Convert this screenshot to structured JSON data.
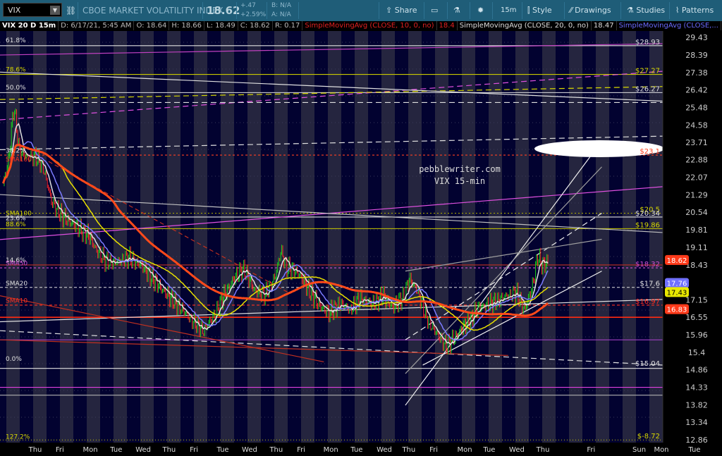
{
  "toolbar": {
    "symbol": "VIX",
    "description": "CBOE MARKET VOLATILITY INDEX",
    "last": "18.62",
    "change": "+.47",
    "change_pct": "+2.59%",
    "bid": "B: N/A",
    "ask": "A: N/A",
    "share": "Share",
    "timeframe": "15m",
    "style": "Style",
    "drawings": "Drawings",
    "studies": "Studies",
    "patterns": "Patterns"
  },
  "legend": {
    "title": "VIX 20 D 15m",
    "date": "D: 6/17/21, 5:45 AM",
    "open": "O: 18.64",
    "high": "H: 18.66",
    "low": "L: 18.49",
    "close": "C: 18.62",
    "range": "R: 0.17",
    "sma10": "SimpleMovingAvg (CLOSE, 10, 0, no)",
    "sma10_val": "18.4",
    "sma20": "SimpleMovingAvg (CLOSE, 20, 0, no)",
    "sma20_val": "18.47",
    "sma50": "SimpleMovingAvg (CLOSE,..."
  },
  "watermark": [
    "pebblewriter.com",
    "VIX 15-min"
  ],
  "chart_data": {
    "type": "line",
    "title": "VIX 15-min",
    "y_scale": "log",
    "ylim": [
      12.86,
      29.43
    ],
    "y_ticks": [
      "29.43",
      "28.39",
      "27.38",
      "26.42",
      "25.48",
      "24.58",
      "23.71",
      "22.88",
      "22.07",
      "21.29",
      "20.54",
      "19.81",
      "19.11",
      "18.43",
      "17.15",
      "16.55",
      "15.96",
      "15.4",
      "14.86",
      "14.33",
      "13.82",
      "13.34",
      "12.86"
    ],
    "x_ticks": [
      {
        "day": 0,
        "label": "Thu"
      },
      {
        "day": 0.92,
        "label": "Fri"
      },
      {
        "day": 2.06,
        "label": "Mon"
      },
      {
        "day": 3.03,
        "label": "Tue"
      },
      {
        "day": 4.04,
        "label": "Wed"
      },
      {
        "day": 5.01,
        "label": "Thu"
      },
      {
        "day": 5.94,
        "label": "Fri"
      },
      {
        "day": 7.02,
        "label": "Tue"
      },
      {
        "day": 8.02,
        "label": "Wed"
      },
      {
        "day": 9.02,
        "label": "Thu"
      },
      {
        "day": 9.95,
        "label": "Fri"
      },
      {
        "day": 11.06,
        "label": "Mon"
      },
      {
        "day": 12.03,
        "label": "Tue"
      },
      {
        "day": 13.06,
        "label": "Wed"
      },
      {
        "day": 13.98,
        "label": "Thu"
      },
      {
        "day": 14.91,
        "label": "Fri"
      },
      {
        "day": 16.07,
        "label": "Mon"
      },
      {
        "day": 16.99,
        "label": "Tue"
      },
      {
        "day": 18.02,
        "label": "Wed"
      },
      {
        "day": 18.998,
        "label": "Thu"
      },
      {
        "day": 20.8,
        "label": "Fri"
      },
      {
        "day": 22.6,
        "label": "Sun"
      },
      {
        "day": 23.43,
        "label": "Mon"
      },
      {
        "day": 24.67,
        "label": "Tue"
      }
    ],
    "close_path": [
      [
        -1.2,
        21.8
      ],
      [
        -1.0,
        22.8
      ],
      [
        -0.8,
        25.6
      ],
      [
        -0.6,
        23.3
      ],
      [
        -0.3,
        23.0
      ],
      [
        0,
        23.0
      ],
      [
        0.3,
        22.5
      ],
      [
        0.6,
        21.0
      ],
      [
        1.0,
        20.4
      ],
      [
        1.5,
        20.0
      ],
      [
        2.0,
        19.6
      ],
      [
        2.3,
        19.0
      ],
      [
        2.6,
        18.6
      ],
      [
        3.0,
        18.5
      ],
      [
        3.5,
        18.7
      ],
      [
        4.0,
        18.4
      ],
      [
        4.5,
        17.8
      ],
      [
        5.0,
        17.3
      ],
      [
        5.5,
        16.8
      ],
      [
        6.0,
        16.3
      ],
      [
        6.3,
        16.1
      ],
      [
        6.7,
        16.6
      ],
      [
        7.0,
        17.2
      ],
      [
        7.4,
        17.9
      ],
      [
        7.8,
        18.3
      ],
      [
        8.2,
        17.5
      ],
      [
        8.6,
        17.3
      ],
      [
        9.0,
        18.0
      ],
      [
        9.2,
        19.0
      ],
      [
        9.4,
        18.3
      ],
      [
        9.8,
        18.2
      ],
      [
        10.2,
        17.6
      ],
      [
        10.6,
        17.0
      ],
      [
        11.0,
        16.7
      ],
      [
        11.4,
        17.0
      ],
      [
        11.8,
        16.8
      ],
      [
        12.2,
        17.2
      ],
      [
        12.6,
        17.0
      ],
      [
        13.0,
        17.3
      ],
      [
        13.4,
        16.9
      ],
      [
        13.8,
        17.3
      ],
      [
        14.0,
        17.9
      ],
      [
        14.3,
        17.5
      ],
      [
        14.6,
        16.6
      ],
      [
        15.0,
        16.0
      ],
      [
        15.4,
        15.6
      ],
      [
        15.8,
        16.0
      ],
      [
        16.2,
        16.4
      ],
      [
        16.6,
        16.9
      ],
      [
        17.0,
        17.0
      ],
      [
        17.5,
        17.2
      ],
      [
        18.0,
        17.4
      ],
      [
        18.3,
        16.8
      ],
      [
        18.6,
        17.6
      ],
      [
        18.8,
        18.8
      ],
      [
        19.0,
        18.4
      ],
      [
        19.2,
        18.62
      ]
    ],
    "studies": [
      {
        "name": "SMA10",
        "color": "#e0e0e0",
        "period": 8
      },
      {
        "name": "SMA20",
        "color": "#7b7bff",
        "period": 20
      },
      {
        "name": "SMA50",
        "color": "#e8e000",
        "period": 50
      },
      {
        "name": "SMA100",
        "color": "#ff4a1a",
        "period": 100
      }
    ],
    "levels": [
      {
        "price": 28.93,
        "color": "#e0e0e0",
        "dash": "",
        "label": "$28.93"
      },
      {
        "price": 27.27,
        "color": "#c8c800",
        "dash": "",
        "label": "$27.27"
      },
      {
        "price": 26.27,
        "color": "#e0e0e0",
        "dash": "",
        "label": "$26.27"
      },
      {
        "price": 23.1,
        "color": "#ff4020",
        "dash": "3,3",
        "label": "$23.1"
      },
      {
        "price": 20.5,
        "color": "#b0b000",
        "dash": "2,3",
        "label": "$20.5"
      },
      {
        "price": 20.34,
        "color": "#e0e0e0",
        "dash": "",
        "label": "$20.34"
      },
      {
        "price": 19.86,
        "color": "#c8c800",
        "dash": "",
        "label": "$19.86"
      },
      {
        "price": 18.43,
        "color": "#c03020",
        "dash": "",
        "label": ""
      },
      {
        "price": 18.32,
        "color": "#d050d0",
        "dash": "3,3",
        "label": "$18.32"
      },
      {
        "price": 17.6,
        "color": "#e0e0e0",
        "dash": "4,3",
        "label": "$17.6"
      },
      {
        "price": 16.97,
        "color": "#ff3020",
        "dash": "4,3",
        "label": "$16.97"
      },
      {
        "price": 16.55,
        "color": "#ff2a10",
        "dash": "",
        "label": ""
      },
      {
        "price": 15.8,
        "color": "#a040c0",
        "dash": "",
        "label": ""
      },
      {
        "price": 14.9,
        "color": "#e0e0e0",
        "dash": "",
        "label": ""
      },
      {
        "price": 14.33,
        "color": "#e040e0",
        "dash": "",
        "label": ""
      },
      {
        "price": 14.1,
        "color": "#b0b0b0",
        "dash": "",
        "label": ""
      },
      {
        "price": 12.86,
        "color": "#c8c800",
        "dash": "1,3",
        "label": "$-8.72"
      }
    ],
    "level_label_15": "$15.04",
    "trendlines": [
      {
        "from": [
          -1.32,
          28.38
        ],
        "to": [
          23.5,
          29.05
        ],
        "color": "#c040c0",
        "dash": ""
      },
      {
        "from": [
          -1.32,
          24.84
        ],
        "to": [
          23.5,
          27.45
        ],
        "color": "#e050e0",
        "dash": "8,5"
      },
      {
        "from": [
          -1.32,
          25.9
        ],
        "to": [
          23.5,
          26.6
        ],
        "color": "#d8d800",
        "dash": "8,5"
      },
      {
        "from": [
          -1.32,
          27.4
        ],
        "to": [
          23.5,
          25.81
        ],
        "color": "#e0e0e0",
        "dash": ""
      },
      {
        "from": [
          -1.32,
          25.74
        ],
        "to": [
          23.5,
          25.74
        ],
        "color": "#e0e0e0",
        "dash": "8,5"
      },
      {
        "from": [
          -1.32,
          23.36
        ],
        "to": [
          23.5,
          24.02
        ],
        "color": "#e0e0e0",
        "dash": "8,5"
      },
      {
        "from": [
          -1.32,
          19.42
        ],
        "to": [
          23.5,
          21.65
        ],
        "color": "#e050e0",
        "dash": ""
      },
      {
        "from": [
          -1.32,
          21.3
        ],
        "to": [
          23.5,
          19.7
        ],
        "color": "#c0c0c0",
        "dash": ""
      },
      {
        "from": [
          -1.32,
          16.4
        ],
        "to": [
          23.5,
          17.17
        ],
        "color": "#e0e0e0",
        "dash": ""
      },
      {
        "from": [
          -1.32,
          16.1
        ],
        "to": [
          23.5,
          15.0
        ],
        "color": "#e0e0e0",
        "dash": "8,5"
      },
      {
        "from": [
          -1.32,
          17.3
        ],
        "to": [
          10.8,
          15.1
        ],
        "color": "#c03020",
        "dash": ""
      },
      {
        "from": [
          -1.32,
          15.8
        ],
        "to": [
          17.7,
          15.3
        ],
        "color": "#c03020",
        "dash": ""
      },
      {
        "from": [
          0.5,
          22.8
        ],
        "to": [
          9.5,
          17.4
        ],
        "color": "#c03020",
        "dash": "6,4"
      },
      {
        "from": [
          13.85,
          13.81
        ],
        "to": [
          21.2,
          23.78
        ],
        "color": "#f0f0f0",
        "dash": ""
      },
      {
        "from": [
          13.85,
          14.74
        ],
        "to": [
          21.2,
          22.55
        ],
        "color": "#a0a0a0",
        "dash": ""
      },
      {
        "from": [
          13.85,
          15.8
        ],
        "to": [
          21.2,
          20.5
        ],
        "color": "#f0f0f0",
        "dash": "8,5"
      },
      {
        "from": [
          13.85,
          18.2
        ],
        "to": [
          21.2,
          19.43
        ],
        "color": "#a0a0a0",
        "dash": ""
      },
      {
        "from": [
          14.5,
          15.0
        ],
        "to": [
          21.2,
          18.2
        ],
        "color": "#f0f0f0",
        "dash": ""
      }
    ],
    "fib_labels": [
      {
        "label": "61.8%",
        "price": 29.26,
        "color": "#e0e0e0"
      },
      {
        "label": "78.6%",
        "price": 27.56,
        "color": "#d8d800"
      },
      {
        "label": "50.0%",
        "price": 26.55,
        "color": "#e0e0e0"
      },
      {
        "label": "38.2%",
        "price": 23.32,
        "color": "#e0e0e0"
      },
      {
        "label": "SMA100",
        "price": 22.9,
        "color": "#ff3020"
      },
      {
        "label": "SMA100",
        "price": 20.5,
        "color": "#d8d800"
      },
      {
        "label": "23.6%",
        "price": 20.3,
        "color": "#e0e0e0"
      },
      {
        "label": "88.6%",
        "price": 20.05,
        "color": "#d8d800"
      },
      {
        "label": "14.6%",
        "price": 18.62,
        "color": "#e0e0e0"
      },
      {
        "label": "SMA50",
        "price": 18.5,
        "color": "#d050d0"
      },
      {
        "label": "SMA20",
        "price": 17.75,
        "color": "#e0e0e0"
      },
      {
        "label": "SMA10",
        "price": 17.13,
        "color": "#ff3020"
      },
      {
        "label": "0.0%",
        "price": 15.2,
        "color": "#e0e0e0"
      },
      {
        "label": "127.2%",
        "price": 12.95,
        "color": "#d8d800"
      }
    ],
    "price_tags": [
      {
        "value": "18.62",
        "price": 18.62,
        "bg": "#ff3a1a",
        "fg": "#fff"
      },
      {
        "value": "17.76",
        "price": 17.76,
        "bg": "#7070ff",
        "fg": "#fff"
      },
      {
        "value": "17.43",
        "price": 17.43,
        "bg": "#e8e800",
        "fg": "#000"
      },
      {
        "value": "16.83",
        "price": 16.83,
        "bg": "#ff3a1a",
        "fg": "#fff"
      }
    ]
  }
}
